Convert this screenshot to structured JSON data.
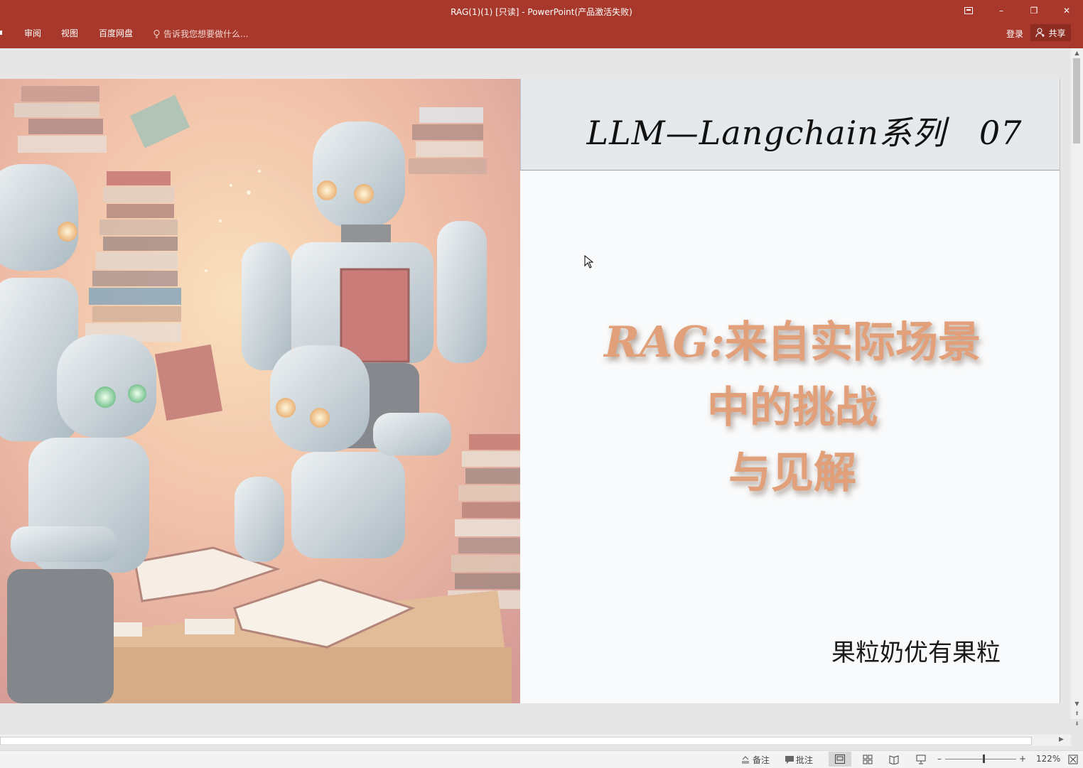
{
  "window": {
    "title": "RAG(1)(1) [只读] - PowerPoint(产品激活失败)",
    "controls": {
      "minimize": "–",
      "restore": "❐",
      "close": "✕"
    }
  },
  "ribbon": {
    "tabs": [
      "审阅",
      "视图",
      "百度网盘"
    ],
    "tell_me": "告诉我您想要做什么...",
    "login": "登录",
    "share": "共享"
  },
  "slide": {
    "banner_title": "LLM—Langchain系列　07",
    "headline_line1_latin": "RAG:",
    "headline_line1_rest": "来自实际场景",
    "headline_line2": "中的挑战",
    "headline_line3": "与见解",
    "author": "果粒奶优有果粒",
    "image_alt": "robots reading books illustration"
  },
  "statusbar": {
    "notes": "备注",
    "comments": "批注",
    "zoom": "122%"
  },
  "colors": {
    "titlebar": "#a8382b",
    "headline": "#e2a07a",
    "banner": "#e5e9ec"
  }
}
